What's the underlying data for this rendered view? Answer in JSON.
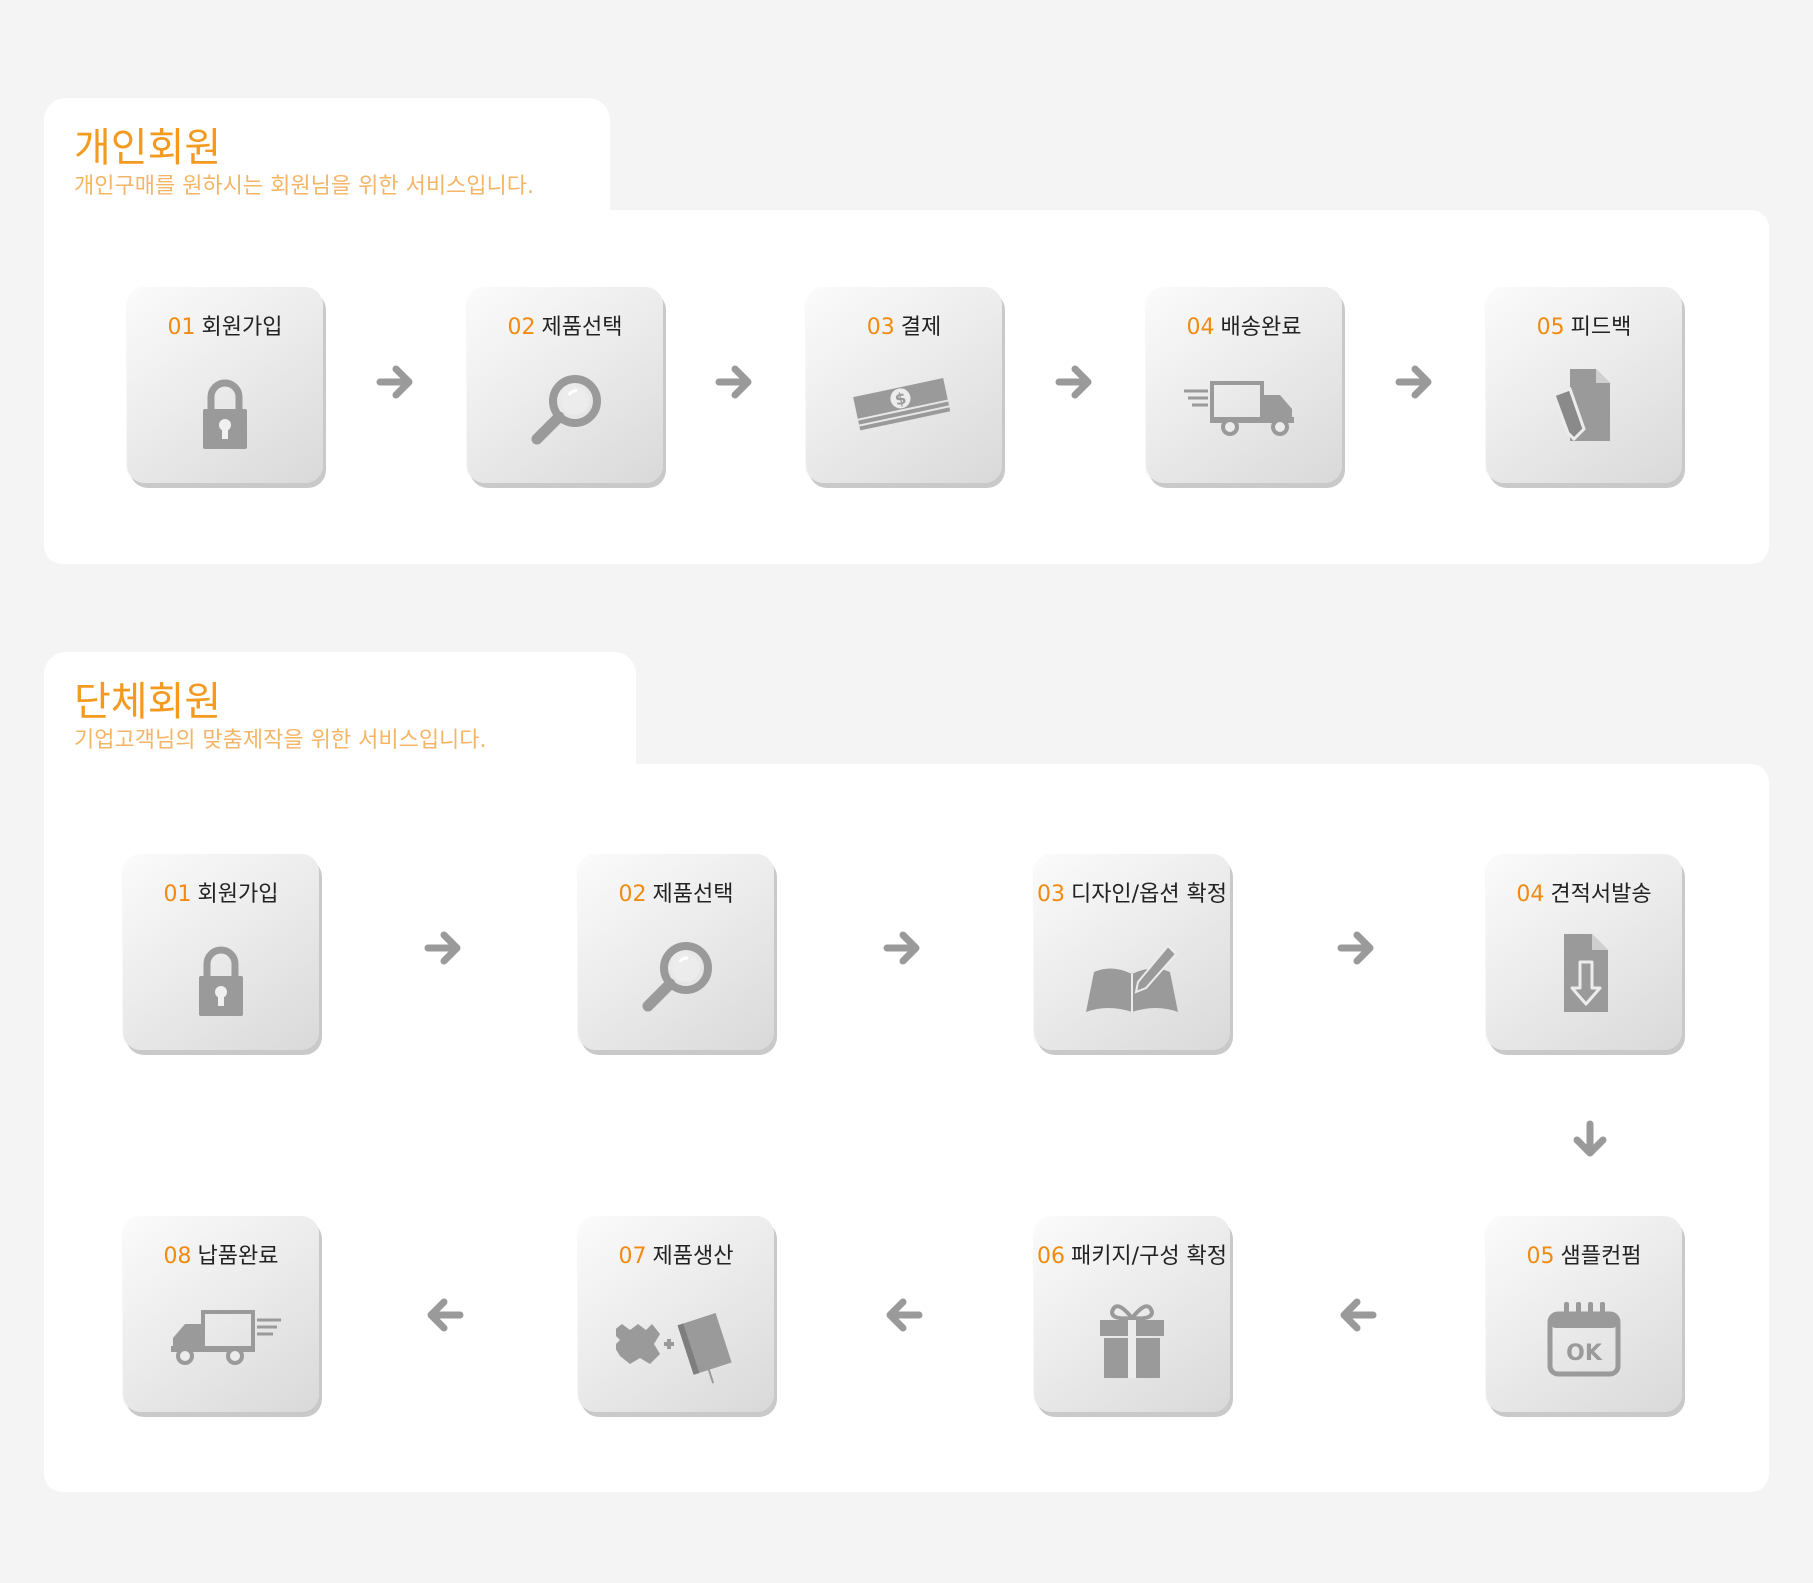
{
  "colors": {
    "accent": "#f39a1f",
    "subtitle": "#f4b567",
    "icon": "#9a9a9a",
    "background": "#f4f4f4"
  },
  "individual": {
    "title": "개인회원",
    "subtitle": "개인구매를 원하시는 회원님을 위한 서비스입니다.",
    "steps": [
      {
        "num": "01",
        "label": "회원가입",
        "icon": "lock-icon"
      },
      {
        "num": "02",
        "label": "제품선택",
        "icon": "magnifier-icon"
      },
      {
        "num": "03",
        "label": "결제",
        "icon": "money-icon"
      },
      {
        "num": "04",
        "label": "배송완료",
        "icon": "truck-icon"
      },
      {
        "num": "05",
        "label": "피드백",
        "icon": "document-pencil-icon"
      }
    ]
  },
  "group": {
    "title": "단체회원",
    "subtitle": "기업고객님의 맞춤제작을 위한 서비스입니다.",
    "steps": [
      {
        "num": "01",
        "label": "회원가입",
        "icon": "lock-icon"
      },
      {
        "num": "02",
        "label": "제품선택",
        "icon": "magnifier-icon"
      },
      {
        "num": "03",
        "label": "디자인/옵션 확정",
        "icon": "book-pen-icon"
      },
      {
        "num": "04",
        "label": "견적서발송",
        "icon": "document-download-icon"
      },
      {
        "num": "05",
        "label": "샘플컨펌",
        "icon": "calendar-ok-icon"
      },
      {
        "num": "06",
        "label": "패키지/구성 확정",
        "icon": "gift-icon"
      },
      {
        "num": "07",
        "label": "제품생산",
        "icon": "leather-plus-book-icon"
      },
      {
        "num": "08",
        "label": "납품완료",
        "icon": "truck-icon"
      }
    ]
  }
}
